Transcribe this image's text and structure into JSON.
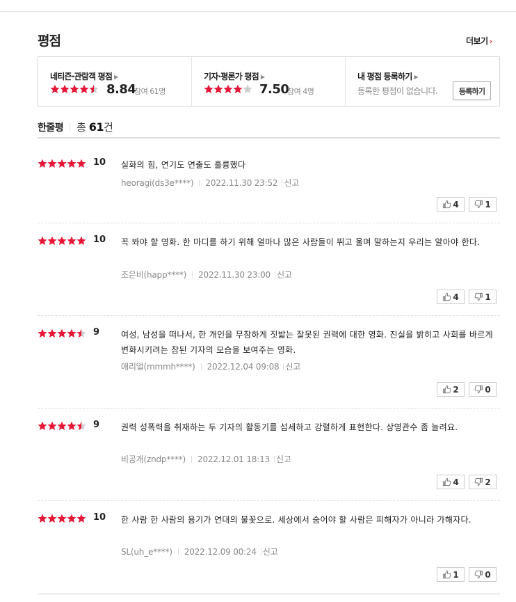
{
  "header": {
    "title": "평점",
    "more_label": "더보기",
    "more_arrow": "›"
  },
  "scores": {
    "netizen": {
      "label": "네티즌·관람객 평점",
      "score": "8.84",
      "count_text": "참여 61명",
      "stars": 4.5
    },
    "critic": {
      "label": "기자·평론가 평점",
      "score": "7.50",
      "count_text": "참여 4명",
      "stars": 4
    },
    "mine": {
      "label": "내 평점 등록하기",
      "empty_text": "등록한 평점이 없습니다.",
      "button_label": "등록하기"
    }
  },
  "summary": {
    "label": "한줄평",
    "total_prefix": "총",
    "total_count": "61",
    "total_suffix": "건"
  },
  "reviews": [
    {
      "stars": 5,
      "score": "10",
      "text": "실화의 힘, 연기도 연출도 훌륭했다",
      "user": "heoragi(ds3e****)",
      "date": "2022.11.30 23:52",
      "report": "신고",
      "up": "4",
      "down": "1"
    },
    {
      "stars": 5,
      "score": "10",
      "text": "꼭 봐야 할 영화. 한 마디를 하기 위해 얼마나 많은 사람들이 뛰고 울며 말하는지 우리는 알아야 한다.",
      "user": "조은비(happ****)",
      "date": "2022.11.30 23:00",
      "report": "신고",
      "up": "4",
      "down": "1"
    },
    {
      "stars": 4.5,
      "score": "9",
      "text": "여성, 남성을 떠나서, 한 개인을 무참하게 짓밟는 잘못된 권력에 대한 영화. 진실을 밝히고 사회를 바르게 변화시키려는 참된 기자의 모습을 보여주는 영화.",
      "user": "애리얼(mmmh****)",
      "date": "2022.12.04 09:08",
      "report": "신고",
      "up": "2",
      "down": "0"
    },
    {
      "stars": 4.5,
      "score": "9",
      "text": "권력 성폭력을 취재하는 두 기자의 활동기를 섬세하고 강렬하게 표현한다. 상영관수 좀 늘려요.",
      "user": "비공개(zndp****)",
      "date": "2022.12.01 18:13",
      "report": "신고",
      "up": "4",
      "down": "2"
    },
    {
      "stars": 5,
      "score": "10",
      "text": "한 사람 한 사람의 용기가 연대의 불꽃으로. 세상에서 숨어야 할 사람은 피해자가 아니라 가해자다.",
      "user": "SL(uh_e****)",
      "date": "2022.12.09 00:24",
      "report": "신고",
      "up": "1",
      "down": "0"
    }
  ],
  "colors": {
    "star_on": "#e51937",
    "star_off": "#cccccc",
    "accent": "#e51937"
  }
}
